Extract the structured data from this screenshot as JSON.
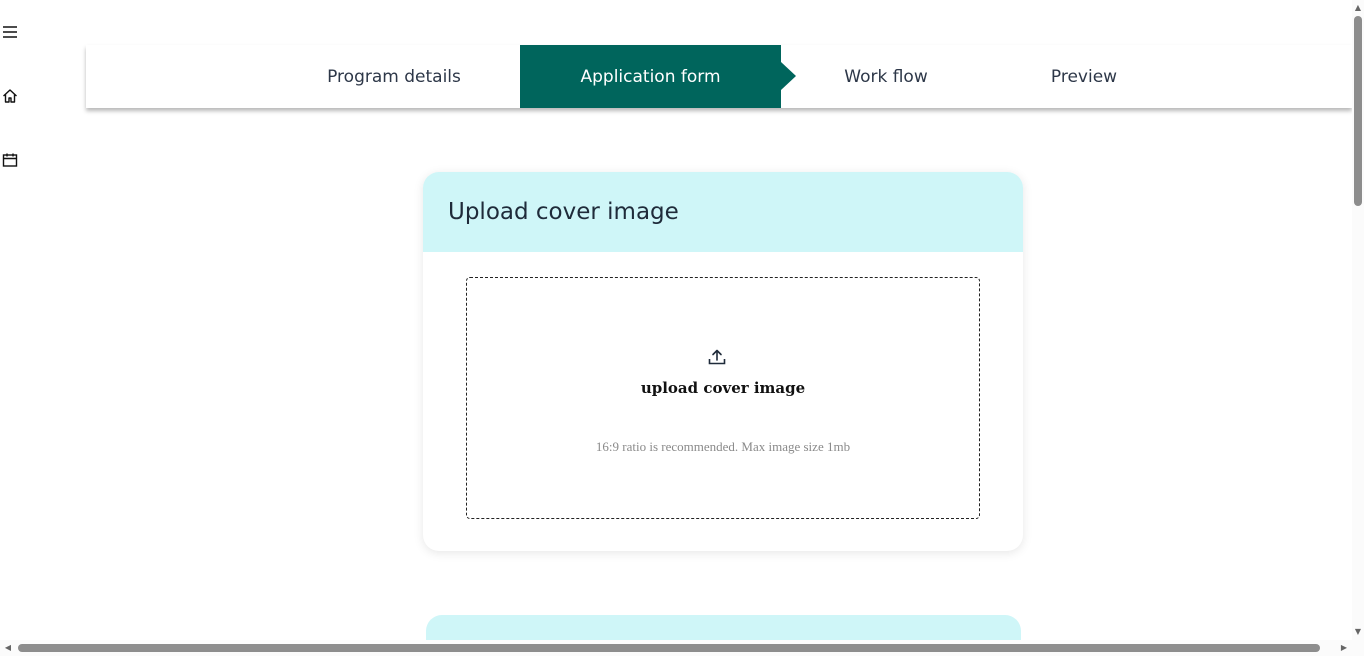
{
  "rail": {
    "icons": [
      "menu-icon",
      "home-icon",
      "calendar-icon"
    ]
  },
  "stepper": {
    "steps": [
      {
        "label": "Program details",
        "active": false
      },
      {
        "label": "Application form",
        "active": true
      },
      {
        "label": "Work flow",
        "active": false
      },
      {
        "label": "Preview",
        "active": false
      }
    ]
  },
  "upload_card": {
    "title": "Upload cover image",
    "drop_label": "upload cover image",
    "hint": "16:9 ratio is recommended. Max image size 1mb",
    "icon": "upload-icon"
  },
  "colors": {
    "active_step": "#00655c",
    "card_header": "#cff6f8"
  }
}
